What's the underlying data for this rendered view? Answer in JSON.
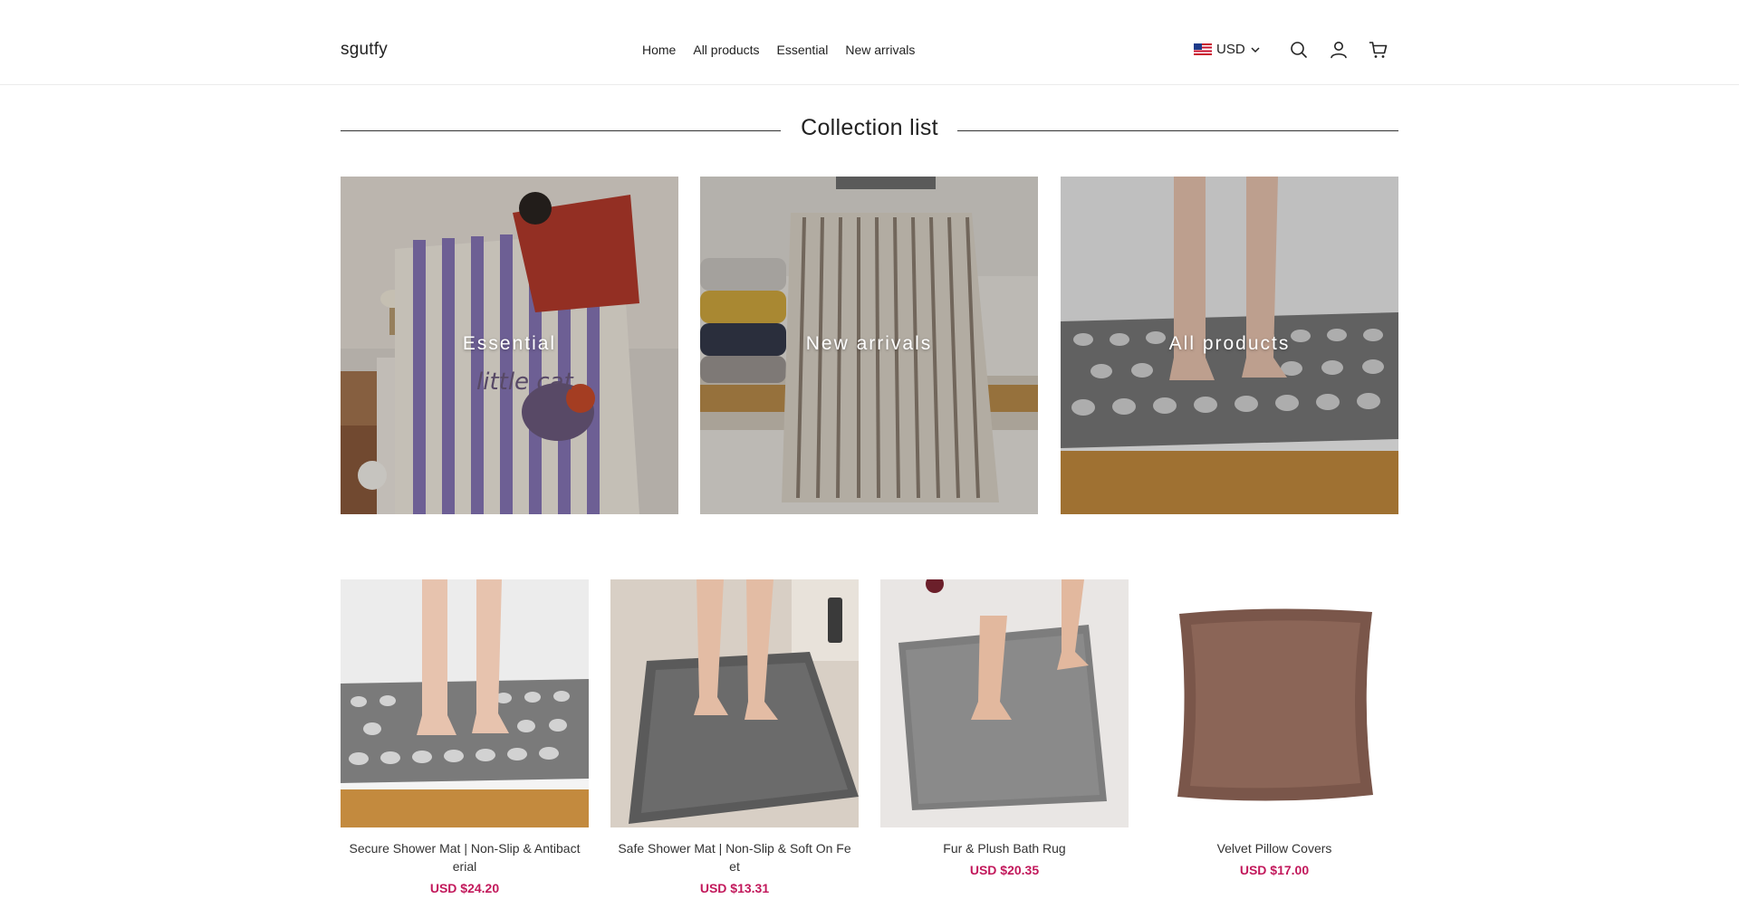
{
  "header": {
    "logo": "sgutfy",
    "nav": [
      "Home",
      "All products",
      "Essential",
      "New arrivals"
    ],
    "currency": "USD",
    "icons": [
      "search-icon",
      "account-icon",
      "cart-icon"
    ]
  },
  "collections": {
    "title": "Collection list",
    "items": [
      {
        "label": "Essential"
      },
      {
        "label": "New arrivals"
      },
      {
        "label": "All products"
      }
    ]
  },
  "products": [
    {
      "name": "Secure Shower Mat | Non-Slip & Antibacterial",
      "price": "USD $24.20"
    },
    {
      "name": "Safe Shower Mat | Non-Slip & Soft On Feet",
      "price": "USD $13.31"
    },
    {
      "name": "Fur & Plush Bath Rug",
      "price": "USD $20.35"
    },
    {
      "name": "Velvet Pillow Covers",
      "price": "USD $17.00"
    }
  ],
  "colors": {
    "price": "#c2185b",
    "text": "#222222",
    "divider": "#333333"
  }
}
